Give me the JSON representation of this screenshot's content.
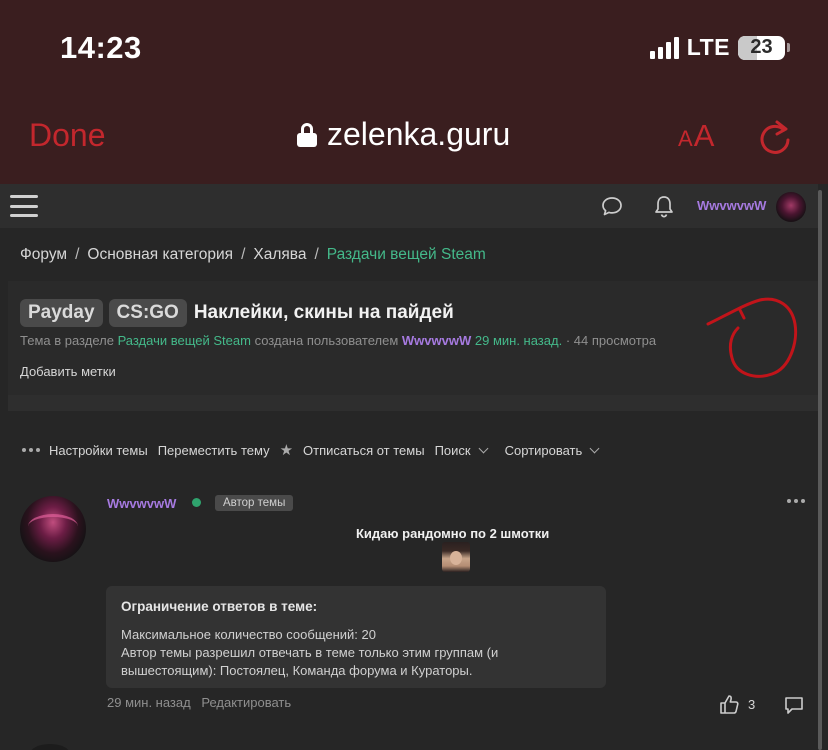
{
  "status_bar": {
    "time": "14:23",
    "network": "LTE",
    "battery": "23"
  },
  "browser": {
    "done_label": "Done",
    "url": "zelenka.guru",
    "text_size_small": "A",
    "text_size_large": "A"
  },
  "header": {
    "username": "WwvwvwW"
  },
  "breadcrumb": {
    "items": [
      "Форум",
      "Основная категория",
      "Халява"
    ],
    "current": "Раздачи вещей Steam",
    "separator": "/"
  },
  "thread": {
    "prefixes": [
      "Payday",
      "CS:GO"
    ],
    "title": "Наклейки, скины на пайдей",
    "meta_prefix": "Тема в разделе",
    "meta_section": "Раздачи вещей Steam",
    "meta_created_by": "создана пользователем",
    "meta_author": "WwvwvwW",
    "meta_time": "29 мин. назад.",
    "meta_views": "· 44 просмотра",
    "add_tags": "Добавить метки"
  },
  "toolbar": {
    "settings": "Настройки темы",
    "move": "Переместить тему",
    "unsubscribe": "Отписаться от темы",
    "search": "Поиск",
    "sort": "Сортировать"
  },
  "post": {
    "author": "WwvwvwW",
    "author_badge": "Автор темы",
    "text": "Кидаю рандомно по 2 шмотки",
    "limit_title": "Ограничение ответов в теме:",
    "limit_max": "Максимальное количество сообщений: 20",
    "limit_groups_1": "Автор темы разрешил отвечать в теме только этим группам (и",
    "limit_groups_2": "вышестоящим): Постоялец, Команда форума и Кураторы.",
    "time": "29 мин. назад",
    "edit": "Редактировать",
    "likes": "3"
  },
  "colors": {
    "accent_green": "#44b98a",
    "username_purple": "#a67ae0",
    "safari_red": "#c3272d"
  }
}
